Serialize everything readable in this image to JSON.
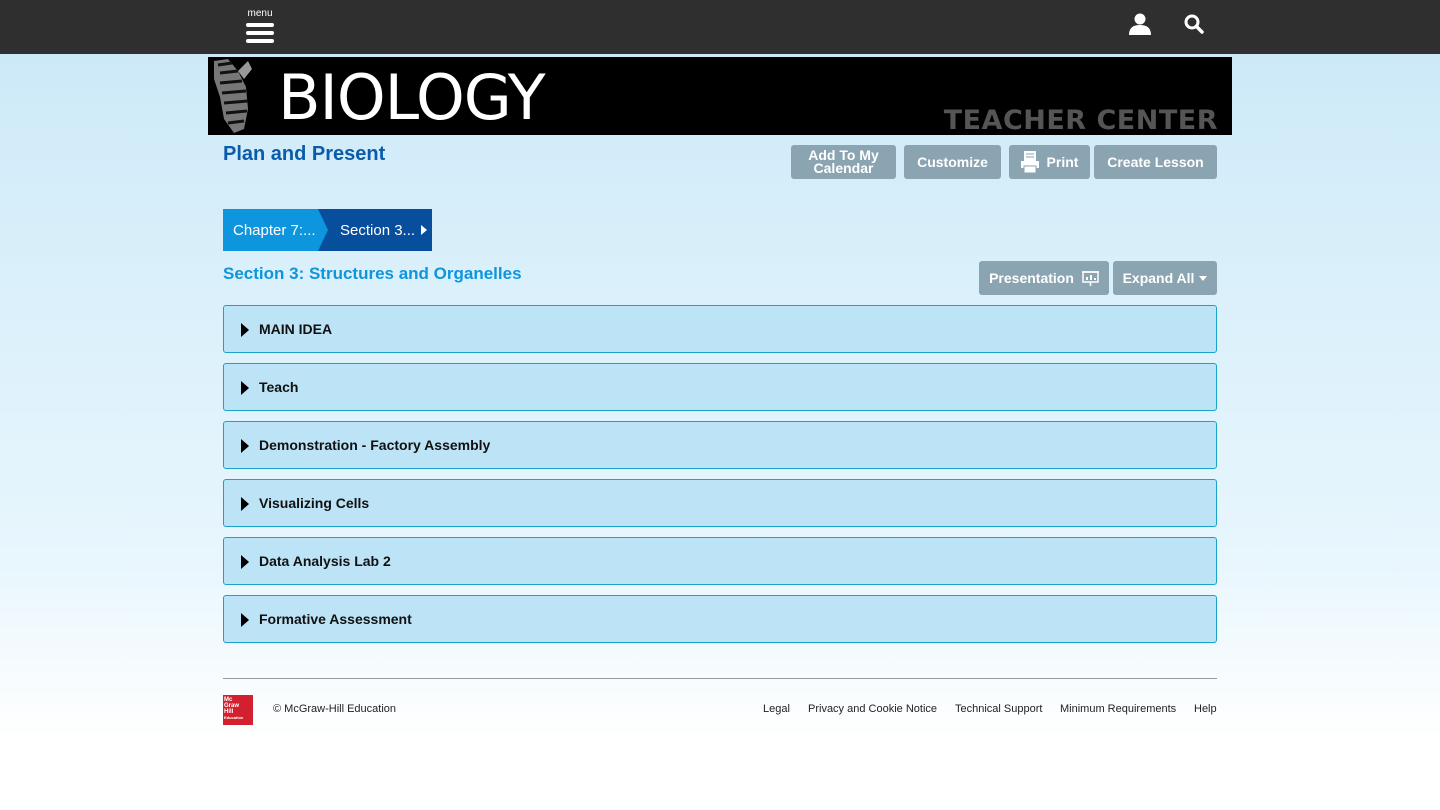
{
  "topbar": {
    "menu_label": "menu",
    "menu_icon": "hamburger-icon",
    "user_icon": "user-icon",
    "search_icon": "search-icon"
  },
  "banner": {
    "title": "BIOLOGY",
    "subtitle": "TEACHER CENTER"
  },
  "page": {
    "title": "Plan and Present"
  },
  "toolbar": {
    "add_calendar_line1": "Add To My",
    "add_calendar_line2": "Calendar",
    "customize": "Customize",
    "print": "Print",
    "create_lesson": "Create Lesson"
  },
  "breadcrumb": {
    "items": [
      {
        "label": "Chapter 7:..."
      },
      {
        "label": "Section 3..."
      }
    ]
  },
  "section": {
    "title": "Section 3: Structures and Organelles",
    "presentation_label": "Presentation",
    "expand_all_label": "Expand All"
  },
  "accordion": {
    "items": [
      {
        "label": "MAIN IDEA"
      },
      {
        "label": "Teach"
      },
      {
        "label": "Demonstration - Factory Assembly"
      },
      {
        "label": "Visualizing Cells"
      },
      {
        "label": "Data Analysis Lab 2"
      },
      {
        "label": "Formative Assessment"
      }
    ]
  },
  "footer": {
    "logo_text": [
      "Mc",
      "Graw",
      "Hill",
      "Education"
    ],
    "copyright": "© McGraw-Hill Education",
    "links": [
      "Legal",
      "Privacy and Cookie Notice",
      "Technical Support",
      "Minimum Requirements",
      "Help"
    ]
  },
  "colors": {
    "topbar": "#2f2f2f",
    "title_blue": "#0a5cab",
    "section_blue": "#0d96dd",
    "button_gray": "#8aa4b2",
    "accordion_bg": "#bde3f6",
    "brand_red": "#d3202f"
  }
}
